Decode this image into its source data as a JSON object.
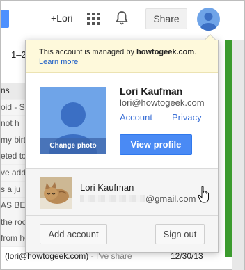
{
  "topbar": {
    "add_user_label": "+Lori",
    "share_label": "Share"
  },
  "background": {
    "range_text": "1–2",
    "list_rows": [
      "ns",
      "oid - S",
      "not h",
      "my birth",
      "eted to",
      "ve add",
      "s a ju",
      "AS BE",
      "the roo",
      "from he"
    ],
    "bottom_sender": "(lori@howtogeek.com)",
    "bottom_snippet": " - I've share",
    "bottom_date": "12/30/13"
  },
  "popup": {
    "managed_prefix": "This account is managed by ",
    "managed_domain": "howtogeek.com",
    "managed_suffix": ".",
    "learn_more": "Learn more",
    "change_photo": "Change photo",
    "name": "Lori Kaufman",
    "email": "lori@howtogeek.com",
    "account_link": "Account",
    "separator": "–",
    "privacy_link": "Privacy",
    "view_profile": "View profile",
    "other_account": {
      "name": "Lori Kaufman",
      "email_suffix": "@gmail.com"
    },
    "add_account": "Add account",
    "sign_out": "Sign out"
  },
  "colors": {
    "accent_blue": "#4a8af4",
    "notice_yellow": "#fef9db",
    "link_blue": "#3a6fd6",
    "avatar_blue": "#6fa4e8"
  },
  "icons": [
    "apps-grid-icon",
    "bell-icon",
    "avatar-icon",
    "cursor-hand-icon"
  ]
}
